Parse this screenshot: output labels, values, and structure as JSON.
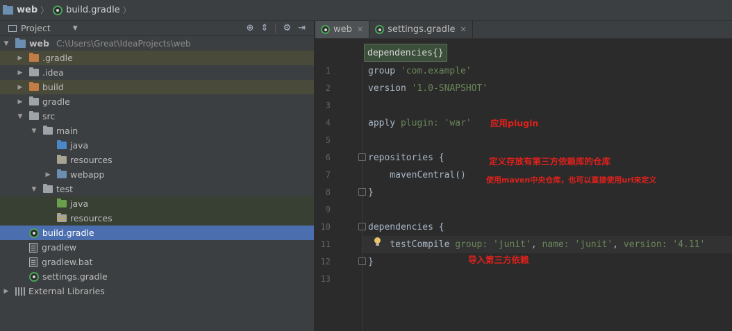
{
  "breadcrumb": {
    "project": "web",
    "file": "build.gradle"
  },
  "project_panel": {
    "title": "Project",
    "tree": [
      {
        "label": "web",
        "path": "C:\\Users\\Great\\IdeaProjects\\web",
        "depth": 0,
        "expanded": true,
        "icon": "module-folder-icon"
      },
      {
        "label": ".gradle",
        "depth": 1,
        "expanded": false,
        "icon": "folder-orange-icon",
        "highlight": "yellow"
      },
      {
        "label": ".idea",
        "depth": 1,
        "expanded": false,
        "icon": "folder-icon"
      },
      {
        "label": "build",
        "depth": 1,
        "expanded": false,
        "icon": "folder-orange-icon",
        "highlight": "yellow"
      },
      {
        "label": "gradle",
        "depth": 1,
        "expanded": false,
        "icon": "folder-icon"
      },
      {
        "label": "src",
        "depth": 1,
        "expanded": true,
        "icon": "folder-icon"
      },
      {
        "label": "main",
        "depth": 2,
        "expanded": true,
        "icon": "folder-icon"
      },
      {
        "label": "java",
        "depth": 3,
        "icon": "source-folder-icon"
      },
      {
        "label": "resources",
        "depth": 3,
        "icon": "resources-folder-icon"
      },
      {
        "label": "webapp",
        "depth": 3,
        "expanded": false,
        "icon": "web-folder-icon"
      },
      {
        "label": "test",
        "depth": 2,
        "expanded": true,
        "icon": "folder-icon"
      },
      {
        "label": "java",
        "depth": 3,
        "icon": "test-folder-icon",
        "highlight": "green"
      },
      {
        "label": "resources",
        "depth": 3,
        "icon": "resources-folder-icon",
        "highlight": "green"
      },
      {
        "label": "build.gradle",
        "depth": 1,
        "icon": "gradle-file-icon",
        "selected": true
      },
      {
        "label": "gradlew",
        "depth": 1,
        "icon": "text-file-icon"
      },
      {
        "label": "gradlew.bat",
        "depth": 1,
        "icon": "text-file-icon"
      },
      {
        "label": "settings.gradle",
        "depth": 1,
        "icon": "gradle-file-icon"
      },
      {
        "label": "External Libraries",
        "depth": 0,
        "expanded": false,
        "icon": "library-icon"
      }
    ]
  },
  "editor": {
    "tabs": [
      {
        "label": "web",
        "active": true
      },
      {
        "label": "settings.gradle",
        "active": false
      }
    ],
    "breadcrumb": "dependencies{}",
    "line_numbers": [
      "1",
      "2",
      "3",
      "4",
      "5",
      "6",
      "7",
      "8",
      "9",
      "10",
      "11",
      "12",
      "13"
    ],
    "lines": {
      "l1": {
        "a": "group ",
        "b": "'com.example'"
      },
      "l2": {
        "a": "version ",
        "b": "'1.0-SNAPSHOT'"
      },
      "l4": {
        "a": "apply ",
        "b": "plugin: ",
        "c": "'war'"
      },
      "l6": {
        "a": "repositories {"
      },
      "l7": {
        "a": "    mavenCentral()"
      },
      "l8": {
        "a": "}"
      },
      "l10": {
        "a": "dependencies {"
      },
      "l11": {
        "a": "    testCompile ",
        "b": "group: ",
        "c": "'junit'",
        "d": ", ",
        "e": "name: ",
        "f": "'junit'",
        "g": ", ",
        "h": "version: ",
        "i": "'4.11'"
      },
      "l12": {
        "a": "}"
      }
    },
    "annotations": {
      "apply_plugin": "应用plugin",
      "repositories": "定义存放有第三方依赖库的仓库",
      "maven_central": "使用maven中央仓库，也可以直接使用url来定义",
      "dependencies": "导入第三方依赖"
    }
  },
  "colors": {
    "annotation": "#e0211c",
    "selection": "#4b6eaf",
    "string": "#6a8759"
  }
}
